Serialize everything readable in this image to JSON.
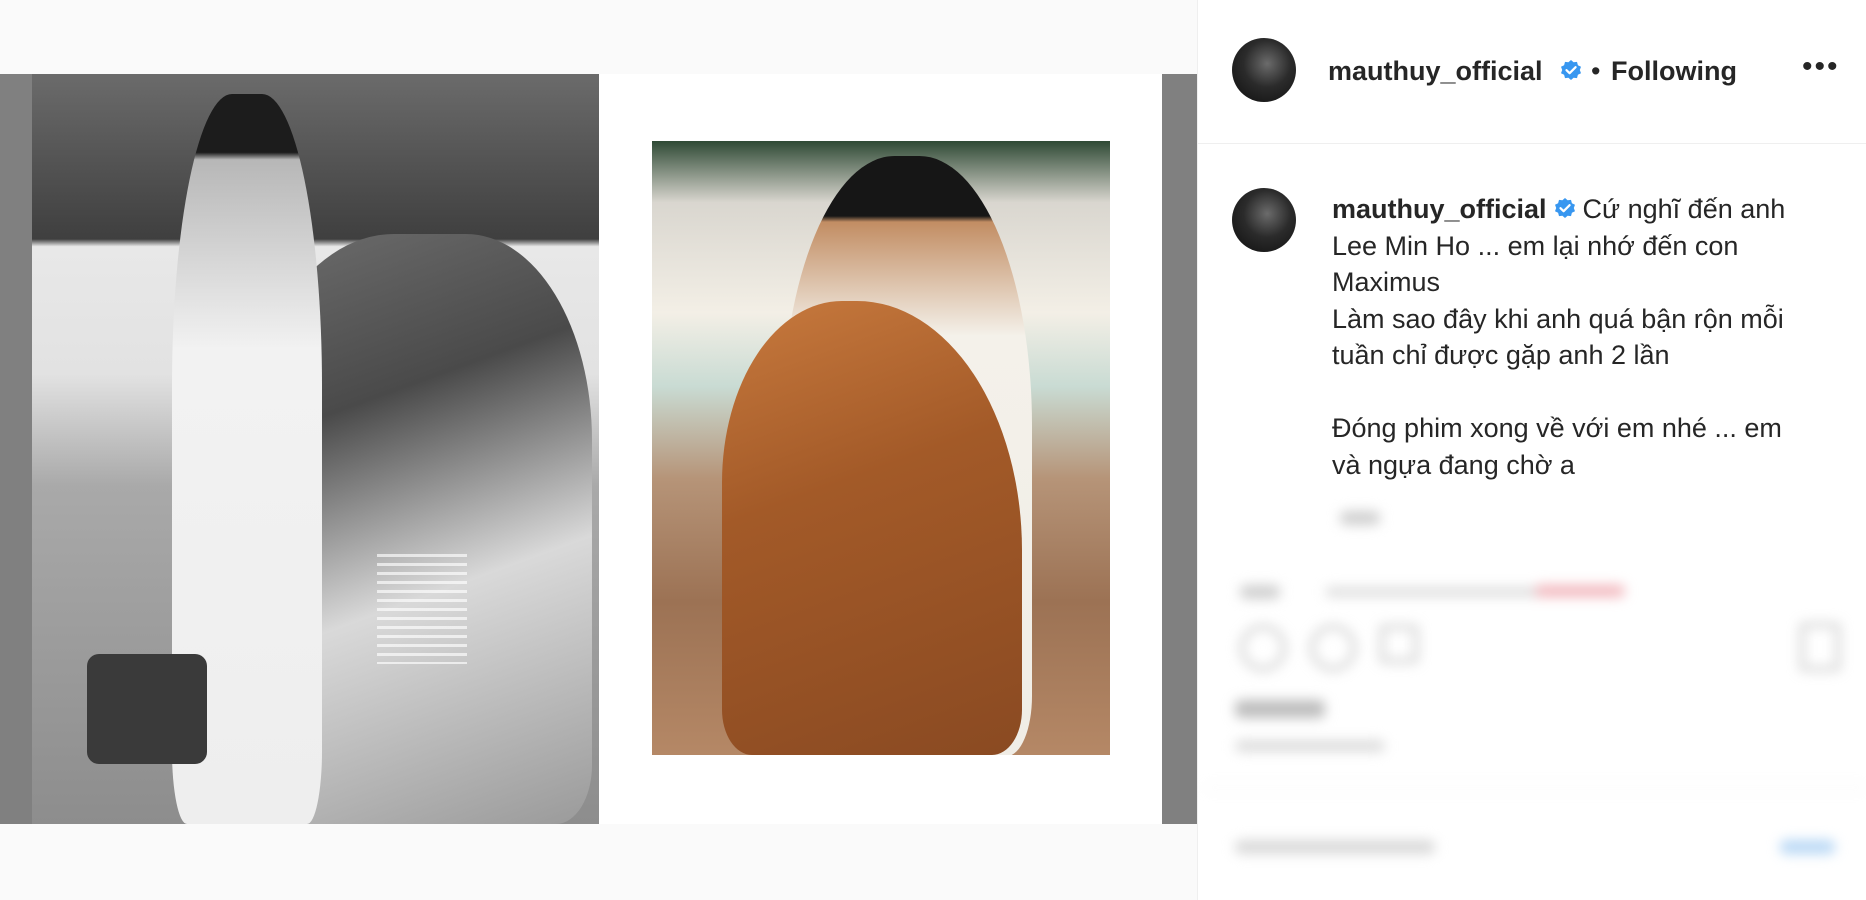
{
  "post": {
    "username": "mauthuy_official",
    "verified": true,
    "separator": "•",
    "follow_status": "Following",
    "more_icon": "more-horizontal-icon",
    "caption_username": "mauthuy_official",
    "caption": "Cứ nghĩ đến anh\nLee Min Ho ... em lại nhớ đến con\nMaximus\nLàm sao đây khi anh quá bận rộn mỗi\ntuần chỉ được gặp anh 2 lần\n\nĐóng phim xong về với em nhé ... em\nvà ngựa đang chờ a"
  },
  "colors": {
    "verified_badge": "#3897f0",
    "text": "#262626"
  }
}
